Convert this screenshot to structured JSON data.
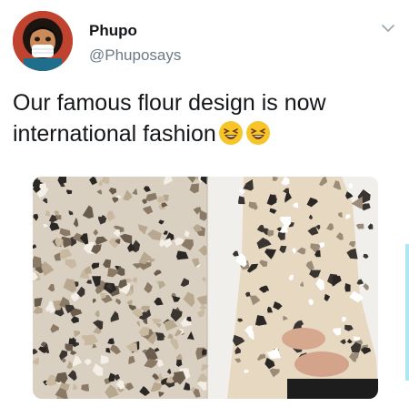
{
  "tweet": {
    "display_name": "Phupo",
    "handle": "@Phuposays",
    "text": "Our famous flour design is now international fashion",
    "emojis": [
      "laughing-face-icon",
      "laughing-face-icon"
    ]
  },
  "icons": {
    "more": "chevron-down-icon"
  },
  "colors": {
    "name": "#14171a",
    "handle": "#6d7a86",
    "emoji": "#f7c52a",
    "avatar_bg": "#b0392f"
  }
}
